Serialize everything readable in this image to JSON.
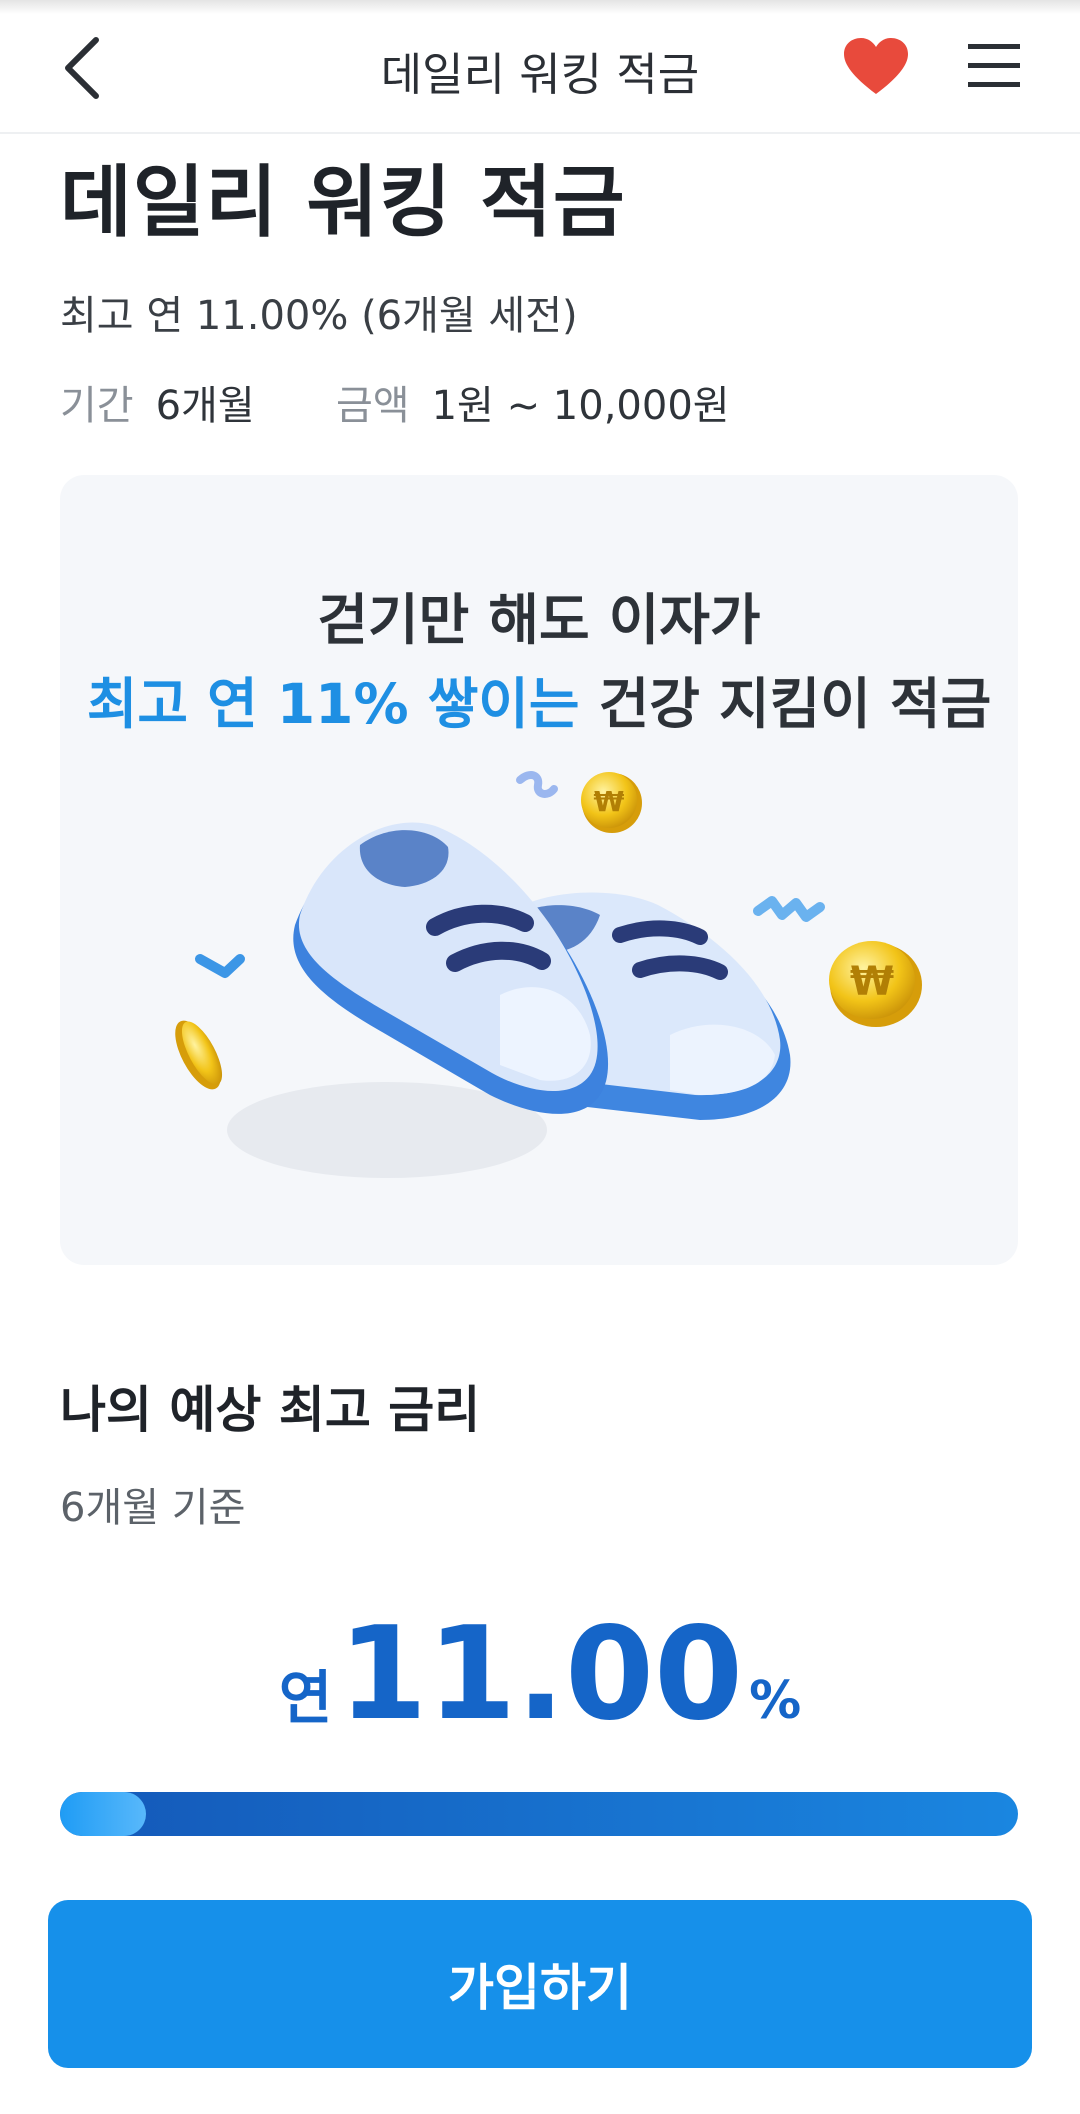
{
  "header": {
    "title": "데일리 워킹 적금",
    "back_icon": "chevron-left-icon",
    "favorite_icon": "heart-icon",
    "menu_icon": "hamburger-menu-icon"
  },
  "product": {
    "title": "데일리 워킹 적금",
    "rate_summary": "최고 연 11.00% (6개월 세전)",
    "period_label": "기간",
    "period_value": "6개월",
    "amount_label": "금액",
    "amount_value": "1원 ~ 10,000원"
  },
  "promo": {
    "line1": "걷기만 해도 이자가",
    "line2_highlight": "최고 연 11% 쌓이는",
    "line2_rest": "건강 지킴이 적금",
    "illustration": "sneakers-with-coins-illustration"
  },
  "estimate": {
    "title": "나의 예상 최고 금리",
    "basis": "6개월 기준",
    "prefix": "연",
    "rate": "11.00",
    "suffix": "%",
    "progress_fraction": 0.09
  },
  "cta": {
    "label": "가입하기"
  },
  "colors": {
    "accent": "#1690ea",
    "rate_blue": "#1565c8",
    "heart": "#e84a3c",
    "highlight": "#1e8fe3"
  }
}
